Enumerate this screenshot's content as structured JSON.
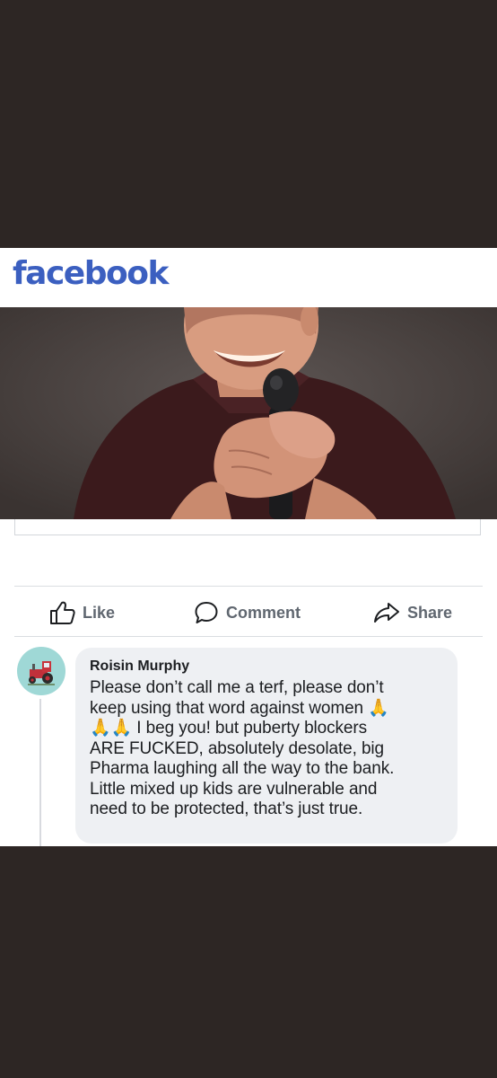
{
  "brand": {
    "logo_text": "facebook",
    "color": "#3b5fc0"
  },
  "post": {
    "photo": {
      "description_icon": "man-laughing-with-microphone-photo"
    }
  },
  "actions": [
    {
      "label": "Like",
      "icon": "thumbs-up-icon"
    },
    {
      "label": "Comment",
      "icon": "comment-bubble-icon"
    },
    {
      "label": "Share",
      "icon": "share-arrow-icon"
    }
  ],
  "comment": {
    "author": "Roisin Murphy",
    "avatar_icon": "red-tractor-avatar",
    "text": "Please don’t call me a terf, please don’t\nkeep using that word against women 🙏\n🙏🙏 I beg you! but puberty blockers\nARE FUCKED, absolutely desolate, big\nPharma laughing all the way to the bank.\nLittle mixed up kids are vulnerable and\nneed to be protected, that’s just true."
  },
  "colors": {
    "background": "#2d2624",
    "action_text": "#606770",
    "bubble": "#eef0f3",
    "avatar_bg": "#9fd8d6"
  }
}
